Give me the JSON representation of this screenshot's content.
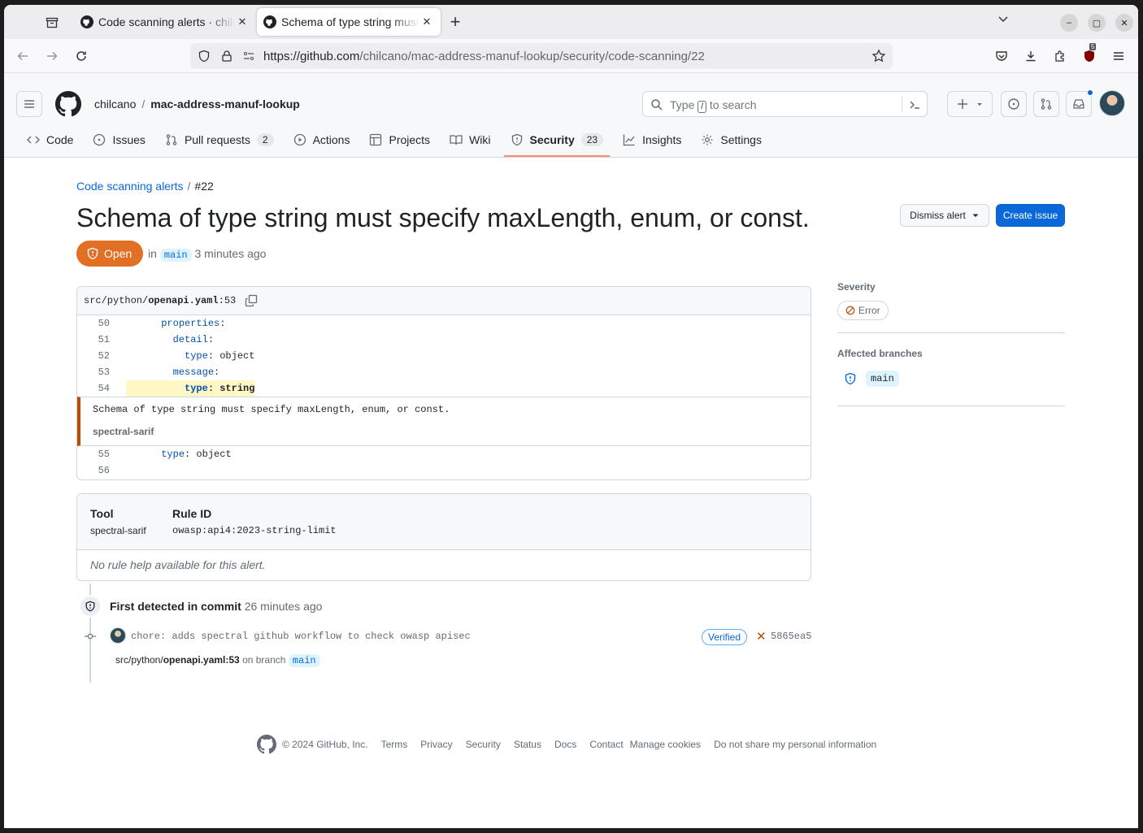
{
  "browser": {
    "tabs": [
      {
        "title": "Code scanning alerts · chilcano/mac-address-manuf-lookup"
      },
      {
        "title": "Schema of type string must specify maxLength"
      }
    ],
    "url_host": "https://github.com",
    "url_path": "/chilcano/mac-address-manuf-lookup/security/code-scanning/22",
    "extension_badge": "5"
  },
  "header": {
    "owner": "chilcano",
    "repo": "mac-address-manuf-lookup",
    "search_placeholder_pre": "Type",
    "search_key": "/",
    "search_placeholder_post": "to search"
  },
  "repo_nav": [
    {
      "label": "Code",
      "icon": "code-icon"
    },
    {
      "label": "Issues",
      "icon": "issue-icon"
    },
    {
      "label": "Pull requests",
      "count": "2",
      "icon": "pull-request-icon"
    },
    {
      "label": "Actions",
      "icon": "play-icon"
    },
    {
      "label": "Projects",
      "icon": "table-icon"
    },
    {
      "label": "Wiki",
      "icon": "book-icon"
    },
    {
      "label": "Security",
      "count": "23",
      "icon": "shield-icon",
      "selected": true
    },
    {
      "label": "Insights",
      "icon": "graph-icon"
    },
    {
      "label": "Settings",
      "icon": "gear-icon"
    }
  ],
  "alert": {
    "breadcrumb_link": "Code scanning alerts",
    "breadcrumb_num": "#22",
    "title": "Schema of type string must specify maxLength, enum, or const.",
    "state": "Open",
    "in_label": "in",
    "branch": "main",
    "time": "3 minutes ago",
    "dismiss_label": "Dismiss alert",
    "create_issue_label": "Create issue"
  },
  "code": {
    "file_dir": "src/python/",
    "file_name": "openapi.yaml",
    "file_line": ":53",
    "lines_before": [
      {
        "n": "50",
        "indent": "      ",
        "key": "properties",
        "rest": ":"
      },
      {
        "n": "51",
        "indent": "        ",
        "key": "detail",
        "rest": ":"
      },
      {
        "n": "52",
        "indent": "          ",
        "key": "type",
        "rest": ": object"
      },
      {
        "n": "53",
        "indent": "        ",
        "key": "message",
        "rest": ":"
      },
      {
        "n": "54",
        "indent": "          ",
        "key": "type",
        "rest": ": string"
      }
    ],
    "message": "Schema of type string must specify maxLength, enum, or const.",
    "tool": "spectral-sarif",
    "lines_after": [
      {
        "n": "55",
        "indent": "      ",
        "key": "type",
        "rest": ": object"
      },
      {
        "n": "56",
        "indent": "",
        "key": "",
        "rest": ""
      }
    ]
  },
  "tool_info": {
    "tool_heading": "Tool",
    "tool_value": "spectral-sarif",
    "rule_heading": "Rule ID",
    "rule_value": "owasp:api4:2023-string-limit",
    "no_help": "No rule help available for this alert."
  },
  "timeline": {
    "first_detected": "First detected in commit",
    "first_time": "26 minutes ago",
    "commit_message": "chore: adds spectral github workflow to check owasp apisec",
    "verified": "Verified",
    "sha": "5865ea5",
    "path_dir": "src/python/",
    "path_file": "openapi.yaml:53",
    "on_branch": "on branch",
    "branch": "main"
  },
  "sidebar": {
    "severity_heading": "Severity",
    "severity": "Error",
    "branches_heading": "Affected branches",
    "branch": "main"
  },
  "footer": {
    "copyright": "© 2024 GitHub, Inc.",
    "links": [
      "Terms",
      "Privacy",
      "Security",
      "Status",
      "Docs",
      "Contact",
      "Manage cookies",
      "Do not share my personal information"
    ]
  },
  "colors": {
    "accent": "#0969da",
    "open_state": "#e16f24",
    "selected_tab_underline": "#fd8c73",
    "alert_border": "#bc4c00"
  }
}
